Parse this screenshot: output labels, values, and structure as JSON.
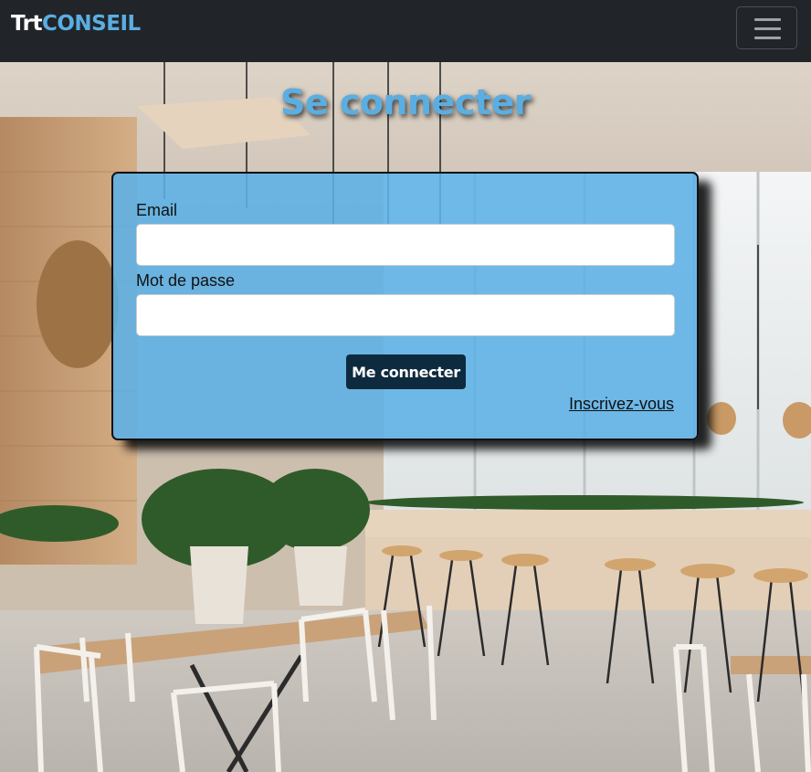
{
  "navbar": {
    "brand_part1": "Trt",
    "brand_part2": "CONSEIL",
    "brand_accent_color": "#5aaee2",
    "toggler_icon": "hamburger-menu-icon"
  },
  "page": {
    "title": "Se connecter"
  },
  "login_form": {
    "email_label": "Email",
    "email_value": "",
    "password_label": "Mot de passe",
    "password_value": "",
    "submit_label": "Me connecter",
    "signup_link": "Inscrivez-vous"
  },
  "background": {
    "description_icon": "cafe-interior-photo"
  }
}
